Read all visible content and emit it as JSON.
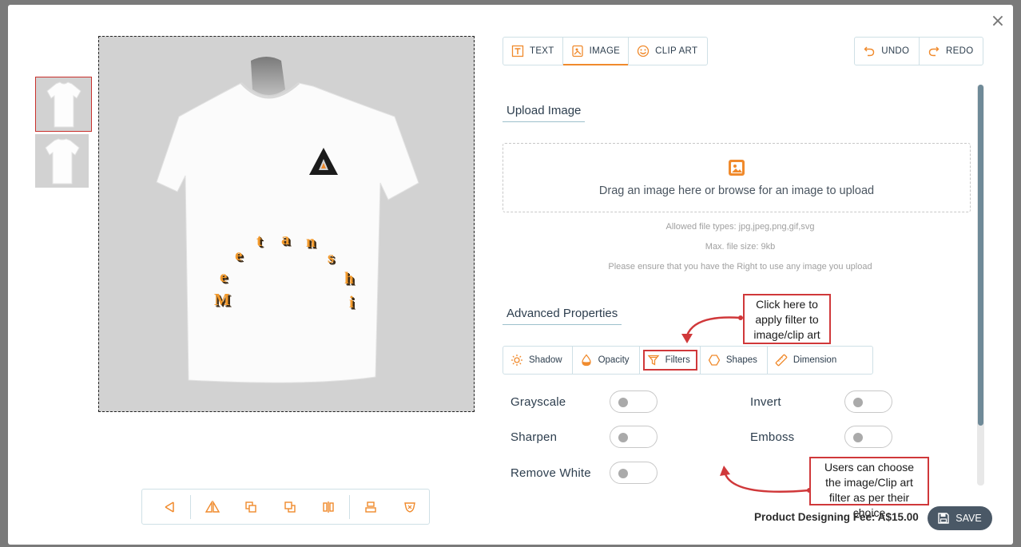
{
  "window": {
    "close_symbol": "×"
  },
  "design": {
    "letters": [
      "M",
      "e",
      "e",
      "t",
      "a",
      "n",
      "s",
      "h",
      "i"
    ]
  },
  "tabs": [
    {
      "label": "TEXT",
      "icon": "text-icon"
    },
    {
      "label": "IMAGE",
      "icon": "image-icon",
      "active": true
    },
    {
      "label": "CLIP ART",
      "icon": "clipart-icon"
    }
  ],
  "history": {
    "undo": "UNDO",
    "redo": "REDO"
  },
  "upload": {
    "title": "Upload Image",
    "drop_text": "Drag an image here or browse for an image to upload",
    "allowed_types": "Allowed file types: jpg,jpeg,png,gif,svg",
    "max_size": "Max. file size: 9kb",
    "rights_note": "Please ensure that you have the Right to use any image you upload"
  },
  "advanced": {
    "title": "Advanced Properties",
    "tabs": [
      "Shadow",
      "Opacity",
      "Filters",
      "Shapes",
      "Dimension"
    ]
  },
  "filters": {
    "grayscale": "Grayscale",
    "invert": "Invert",
    "sharpen": "Sharpen",
    "emboss": "Emboss",
    "remove_white": "Remove White"
  },
  "callouts": {
    "filter_hint": "Click here to apply filter to image/clip art",
    "choice_hint": "Users can choose the image/Clip art filter as per their choice"
  },
  "footer": {
    "fee": "Product Designing Fee: A$15.00",
    "save": "SAVE"
  },
  "colors": {
    "accent": "#f08a2c",
    "callout_border": "#d0383a",
    "save_bg": "#4a5866"
  }
}
